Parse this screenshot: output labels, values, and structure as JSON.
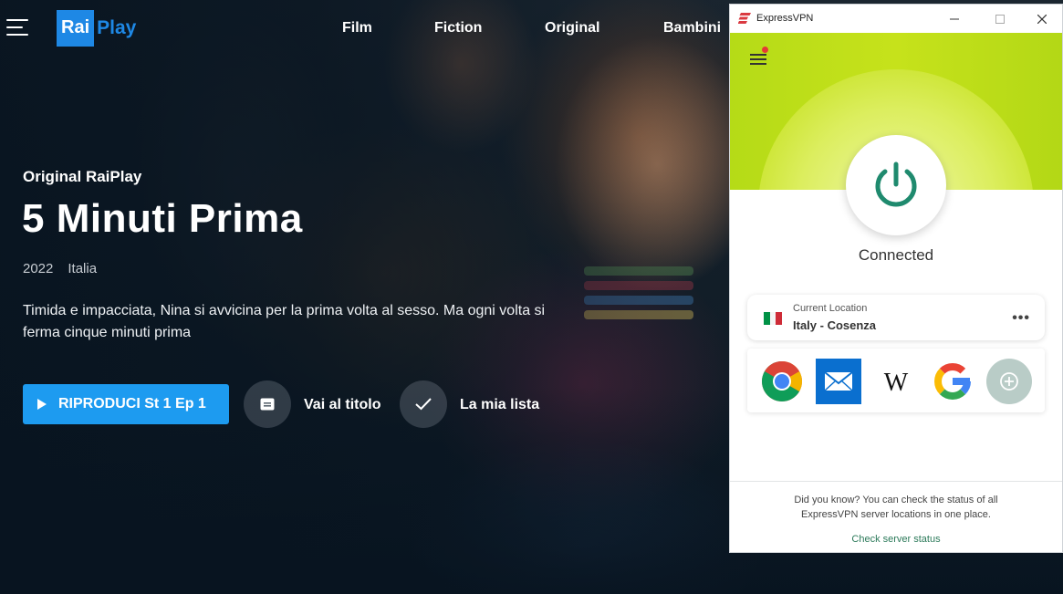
{
  "raiplay": {
    "logo": {
      "rai": "Rai",
      "play": "Play"
    },
    "nav": [
      "Film",
      "Fiction",
      "Original",
      "Bambini"
    ],
    "hero": {
      "eyebrow": "Original RaiPlay",
      "title": "5 Minuti Prima",
      "year": "2022",
      "country": "Italia",
      "description": "Timida e impacciata, Nina si avvicina per la prima volta al sesso. Ma ogni volta si ferma cinque minuti prima",
      "play_label": "RIPRODUCI St 1 Ep 1",
      "details_label": "Vai al titolo",
      "mylist_label": "La mia lista"
    }
  },
  "vpn": {
    "window_title": "ExpressVPN",
    "status": "Connected",
    "location": {
      "label": "Current Location",
      "value": "Italy - Cosenza",
      "flag_colors": [
        "#009246",
        "#ffffff",
        "#ce2b37"
      ]
    },
    "shortcuts": [
      "chrome-icon",
      "mail-icon",
      "wikipedia-icon",
      "google-icon",
      "add-shortcut-icon"
    ],
    "wikipedia_glyph": "W",
    "tip_text": "Did you know? You can check the status of all ExpressVPN server locations in one place.",
    "tip_link": "Check server status",
    "accent": "#1f8a6e",
    "brand_red": "#da3940"
  }
}
